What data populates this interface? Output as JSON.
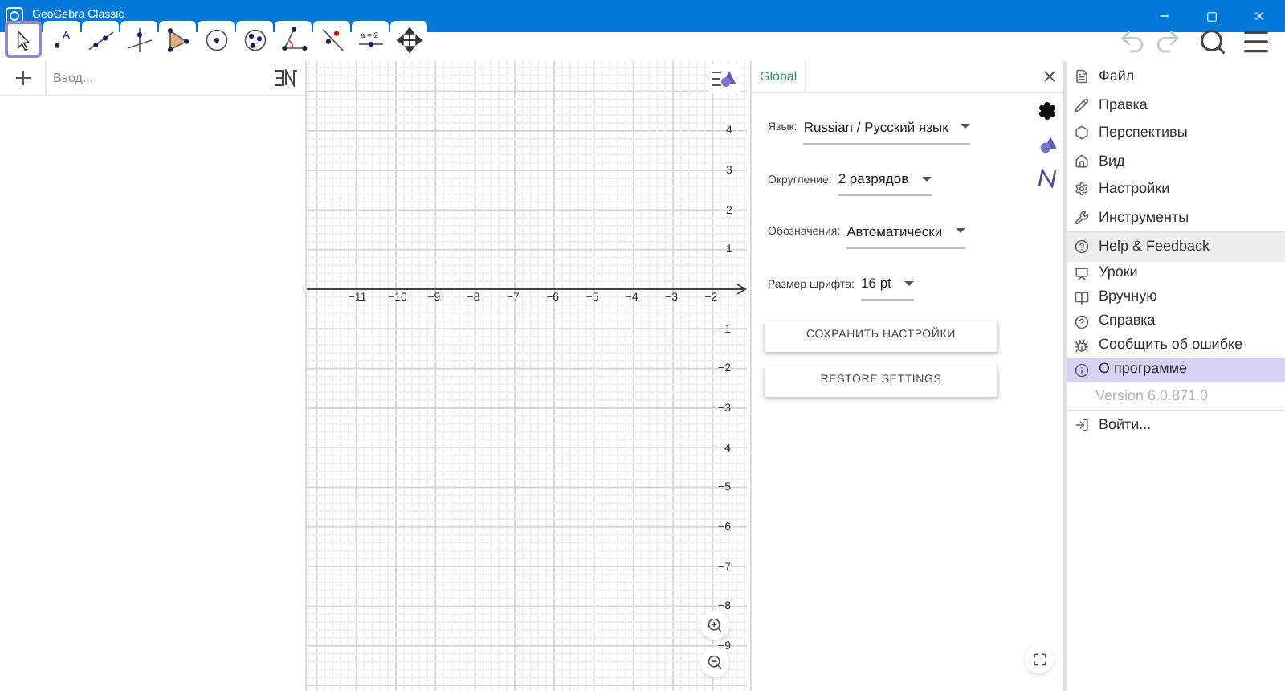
{
  "window": {
    "title": "GeoGebra Classic"
  },
  "toolbar": {
    "tools": [
      {
        "kind": "move",
        "selected": true
      },
      {
        "kind": "point",
        "label": "A",
        "selected": false
      },
      {
        "kind": "line",
        "selected": false
      },
      {
        "kind": "perpendicular",
        "selected": false
      },
      {
        "kind": "polygon",
        "selected": false
      },
      {
        "kind": "circle",
        "selected": false
      },
      {
        "kind": "conic",
        "selected": false
      },
      {
        "kind": "angle",
        "selected": false
      },
      {
        "kind": "reflect",
        "selected": false
      },
      {
        "kind": "slider",
        "label": "a = 2",
        "selected": false
      },
      {
        "kind": "pan",
        "selected": false
      }
    ]
  },
  "algebra": {
    "input": {
      "placeholder": "Ввод..."
    }
  },
  "graphics": {
    "x_ticks": [
      "−11",
      "−10",
      "−9",
      "−8",
      "−7",
      "−6",
      "−5",
      "−4",
      "−3",
      "−2"
    ],
    "y_ticks_positive": [
      "4",
      "3",
      "2",
      "1"
    ],
    "y_ticks_negative": [
      "−1",
      "−2",
      "−3",
      "−4",
      "−5",
      "−6",
      "−7",
      "−8",
      "−9"
    ]
  },
  "settings": {
    "tabs": [
      {
        "label": "Global",
        "selected": true
      }
    ],
    "rows": [
      {
        "label": "Язык:",
        "value": "Russian / Русский язык"
      },
      {
        "label": "Округление:",
        "value": "2 разрядов"
      },
      {
        "label": "Обозначения:",
        "value": "Автоматически"
      },
      {
        "label": "Размер шрифта:",
        "value": "16 pt"
      }
    ],
    "buttons": [
      "СОХРАНИТЬ НАСТРОЙКИ",
      "RESTORE SETTINGS"
    ]
  },
  "menu": {
    "items": [
      {
        "kind": "file",
        "label": "Файл",
        "selected": false
      },
      {
        "kind": "edit",
        "label": "Правка",
        "selected": false
      },
      {
        "kind": "perspectives",
        "label": "Перспективы",
        "selected": false
      },
      {
        "kind": "view",
        "label": "Вид",
        "selected": false
      },
      {
        "kind": "settings",
        "label": "Настройки",
        "selected": false
      },
      {
        "kind": "tools",
        "label": "Инструменты",
        "selected": false
      },
      {
        "kind": "help",
        "label": "Help & Feedback",
        "selected": false,
        "expanded": true,
        "children": [
          {
            "kind": "tutorials",
            "label": "Уроки",
            "selected": false
          },
          {
            "kind": "manual",
            "label": "Вручную",
            "selected": false
          },
          {
            "kind": "question",
            "label": "Справка",
            "selected": false
          },
          {
            "kind": "bug",
            "label": "Сообщить об ошибке",
            "selected": false
          },
          {
            "kind": "info",
            "label": "О программе",
            "selected": true
          }
        ]
      },
      {
        "kind": "version",
        "label": "Version 6.0.871.0",
        "selected": false
      },
      {
        "kind": "signin",
        "label": "Войти...",
        "selected": false
      }
    ]
  }
}
